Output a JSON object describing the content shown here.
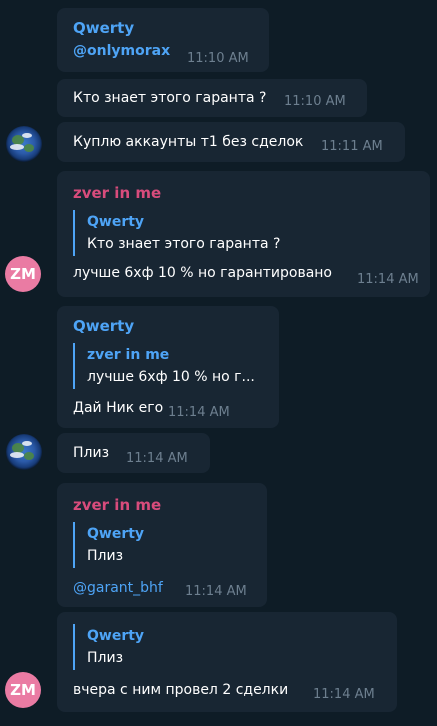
{
  "messages": {
    "m1": {
      "sender": "Qwerty",
      "mention": "@onlymorax",
      "time": "11:10 AM"
    },
    "m2": {
      "text": "Кто знает этого гаранта ?",
      "time": "11:10 AM"
    },
    "m3": {
      "text": "Куплю аккаунты т1 без сделок",
      "time": "11:11 AM"
    },
    "m4": {
      "sender": "zver in me",
      "reply_name": "Qwerty",
      "reply_text": "Кто знает этого гаранта ?",
      "text": "лучше 6хф 10 % но гарантировано",
      "time": "11:14 AM",
      "avatar": "ZM"
    },
    "m5": {
      "sender": "Qwerty",
      "reply_name": "zver in me",
      "reply_text": "лучше 6хф 10 % но г...",
      "text": "Дай Ник его",
      "time": "11:14 AM"
    },
    "m6": {
      "text": "Плиз",
      "time": "11:14 AM"
    },
    "m7": {
      "sender": "zver in me",
      "reply_name": "Qwerty",
      "reply_text": "Плиз",
      "mention": "@garant_bhf",
      "time": "11:14 AM"
    },
    "m8": {
      "reply_name": "Qwerty",
      "reply_text": "Плиз",
      "text": "вчера с ним провел 2 сделки",
      "time": "11:14 AM",
      "avatar": "ZM"
    }
  },
  "colors": {
    "background": "#0e1c26",
    "bubble": "#182633",
    "accent_blue": "#4ea4f6",
    "accent_pink": "#d84c7c",
    "avatar_zm": "#ea7ba3",
    "timestamp": "#6d7f8f"
  }
}
